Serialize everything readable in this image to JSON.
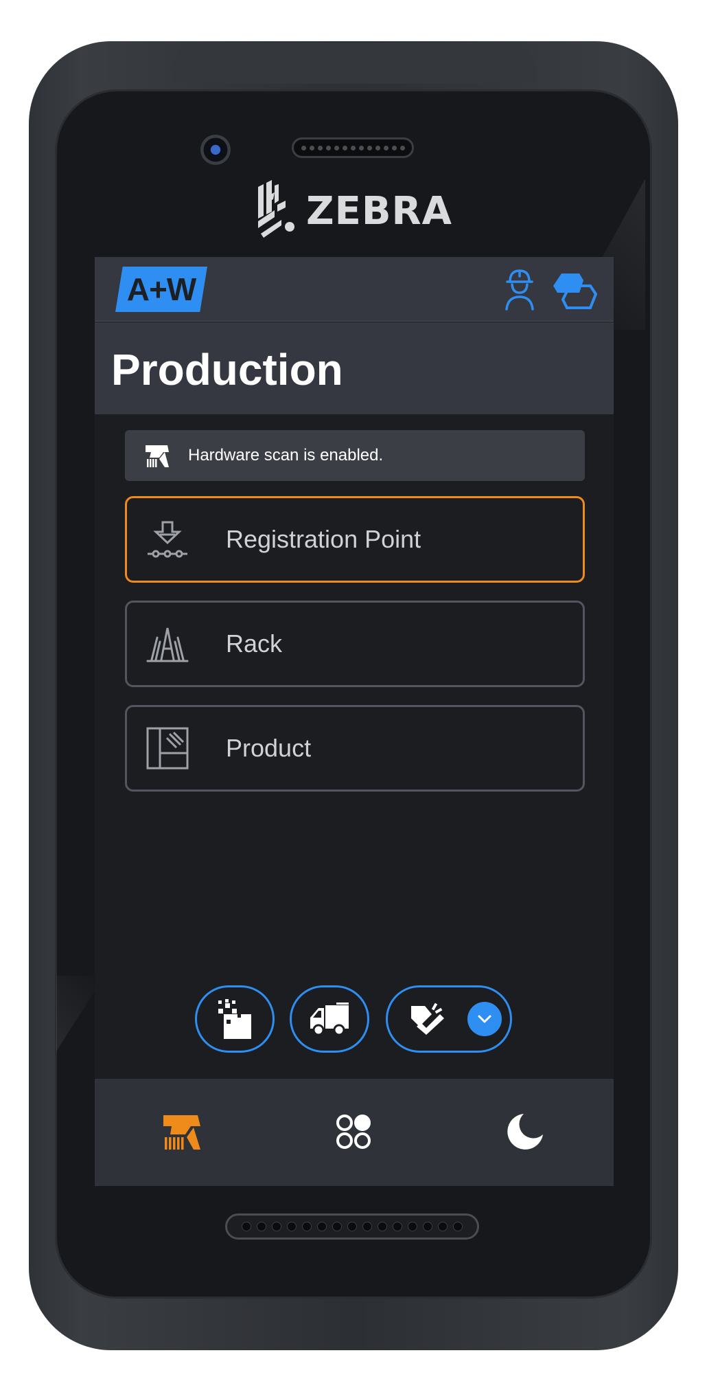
{
  "device": {
    "brand": "ZEBRA"
  },
  "app": {
    "brand_badge": "A+W",
    "header_icons": [
      "worker-icon",
      "apps-icon"
    ],
    "page_title": "Production",
    "scan_banner": {
      "icon": "scanner-icon",
      "text": "Hardware scan is enabled."
    },
    "menu": [
      {
        "label": "Registration Point",
        "icon": "registration-point-icon",
        "active": true
      },
      {
        "label": "Rack",
        "icon": "rack-icon",
        "active": false
      },
      {
        "label": "Product",
        "icon": "product-icon",
        "active": false
      }
    ],
    "actions": [
      "scan-data-icon",
      "delivery-truck-icon",
      "check-tag-icon",
      "chevron-down-icon"
    ],
    "bottom_nav": [
      {
        "icon": "scanner-icon",
        "active": true
      },
      {
        "icon": "apps-grid-icon",
        "active": false
      },
      {
        "icon": "dark-mode-icon",
        "active": false
      }
    ],
    "colors": {
      "accent_blue": "#2e8ef1",
      "active_orange": "#ef8b1a",
      "appbar": "#353840",
      "background": "#1b1d20"
    }
  }
}
